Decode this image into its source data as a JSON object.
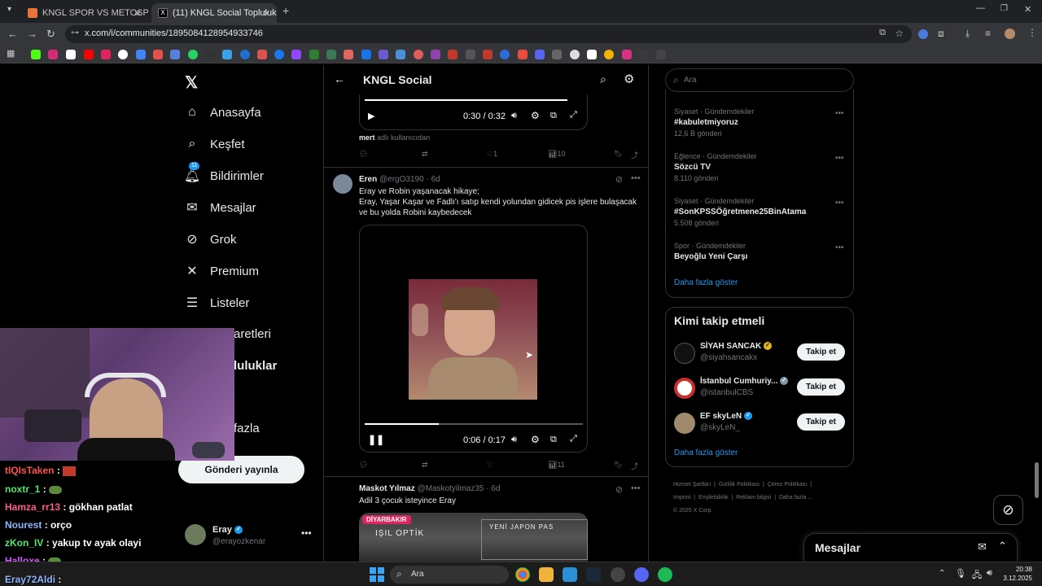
{
  "browser": {
    "tabs": [
      {
        "title": "KNGL SPOR VS METOSPOR De"
      },
      {
        "title": "(11) KNGL Social Topluluk /"
      }
    ],
    "url": "x.com/i/communities/1895084128954933746"
  },
  "nav": {
    "items": [
      {
        "label": "Anasayfa"
      },
      {
        "label": "Keşfet"
      },
      {
        "label": "Bildirimler",
        "badge": "11"
      },
      {
        "label": "Mesajlar"
      },
      {
        "label": "Grok"
      },
      {
        "label": "Premium"
      },
      {
        "label": "Listeler"
      },
      {
        "label": "aretleri"
      },
      {
        "label": "luluklar"
      },
      {
        "label": "fazla"
      }
    ],
    "post_button": "Gönderi yayınla",
    "profile": {
      "name": "Eray",
      "handle": "@erayozkenar"
    }
  },
  "header": {
    "title": "KNGL Social"
  },
  "posts": [
    {
      "video_time": "0:30 / 0:32",
      "username_note_user": "mert",
      "username_note": "adlı kullanıcıdan",
      "likes": "1",
      "views": "10"
    },
    {
      "author": "Eren",
      "handle": "@ergO3190",
      "age": "6d",
      "text_line1": "Eray ve Robin yaşanacak hikaye;",
      "text_line2": "Eray, Yaşar Kaşar ve Fadlı'ı satıp kendi yolundan gidicek pis işlere bulaşacak",
      "text_line3": "ve bu yolda Robini kaybedecek",
      "video_time": "0:06 / 0:17",
      "video_progress": 0.34,
      "views": "11"
    },
    {
      "author": "Maskot Yılmaz",
      "handle": "@Maskotyilmaz35",
      "age": "6d",
      "text": "Adil 3 çocuk isteyince Eray",
      "image_label": "DİYARBAKIR",
      "image_text_1": "IŞIL OPTİK",
      "image_text_2": "YENİ JAPON PAS"
    }
  ],
  "search": {
    "placeholder": "Ara"
  },
  "trends": [
    {
      "category": "Siyaset · Gündemdekiler",
      "title": "#kabuletmiyoruz",
      "count": "12,6 B gönderi"
    },
    {
      "category": "Eğlence · Gündemdekiler",
      "title": "Sözcü TV",
      "count": "8.110 gönderi"
    },
    {
      "category": "Siyaset · Gündemdekiler",
      "title": "#SonKPSSÖğretmene25BinAtama",
      "count": "5.508 gönderi"
    },
    {
      "category": "Spor · Gündemdekiler",
      "title": "Beyoğlu Yeni Çarşı",
      "count": ""
    }
  ],
  "trends_more": "Daha fazla göster",
  "who_to_follow": {
    "title": "Kimi takip etmeli",
    "accounts": [
      {
        "name": "SİYAH SANCAK",
        "handle": "@siyahsancakx",
        "button": "Takip et"
      },
      {
        "name": "İstanbul Cumhuriy...",
        "handle": "@istanbulCBS",
        "button": "Takip et"
      },
      {
        "name": "EF skyLeN",
        "handle": "@skyLeN_",
        "button": "Takip et"
      }
    ],
    "more": "Daha fazla göster"
  },
  "footer": {
    "links": [
      "Hizmet Şartları",
      "Gizlilik Politikası",
      "Çerez Politikası",
      "Imprint",
      "Erişilebilirlik",
      "Reklam bilgisi",
      "Daha fazla ..."
    ],
    "copyright": "© 2025 X Corp."
  },
  "messages_bar": {
    "title": "Mesajlar"
  },
  "chat": [
    {
      "user": "tIQIsTaken",
      "color": "#ff4f4f",
      "text": ":"
    },
    {
      "user": "noxtr_1",
      "color": "#4fe86b",
      "text": ":"
    },
    {
      "user": "Hamza_rr13",
      "color": "#ff5c8a",
      "text": ": gökhan patlat"
    },
    {
      "user": "Nourest",
      "color": "#8fb6ff",
      "text": ": orço"
    },
    {
      "user": "zKon_IV",
      "color": "#4fe86b",
      "text": ": yakup tv ayak olayi"
    },
    {
      "user": "Halloxe",
      "color": "#d45cff",
      "text": ":"
    },
    {
      "user": "Eray72Aldi",
      "color": "#8fb6ff",
      "text": ":"
    }
  ],
  "taskbar": {
    "search": "Ara",
    "time": "20:38",
    "date": "3.12.2025"
  }
}
